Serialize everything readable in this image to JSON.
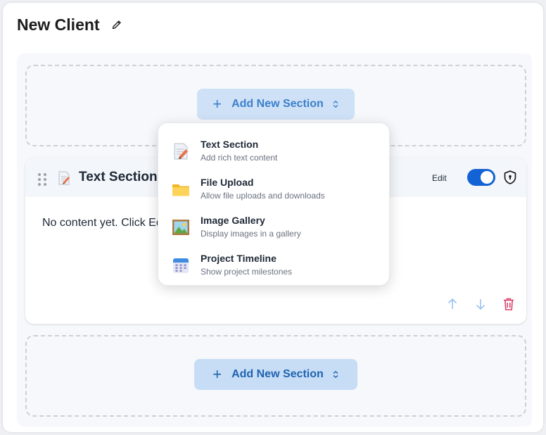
{
  "page": {
    "title": "New Client"
  },
  "add_section": {
    "label": "Add New Section"
  },
  "section_card": {
    "title": "Text Section",
    "edit_label": "Edit",
    "toggle_on": true,
    "body_text": "No content yet. Click Ed"
  },
  "section_menu": {
    "items": [
      {
        "title": "Text Section",
        "description": "Add rich text content",
        "icon": "text-document-icon"
      },
      {
        "title": "File Upload",
        "description": "Allow file uploads and downloads",
        "icon": "folder-icon"
      },
      {
        "title": "Image Gallery",
        "description": "Display images in a gallery",
        "icon": "image-icon"
      },
      {
        "title": "Project Timeline",
        "description": "Show project milestones",
        "icon": "calendar-icon"
      }
    ]
  },
  "colors": {
    "accent": "#1463d6",
    "delete": "#d9436b",
    "arrows": "#9cc3ec"
  }
}
